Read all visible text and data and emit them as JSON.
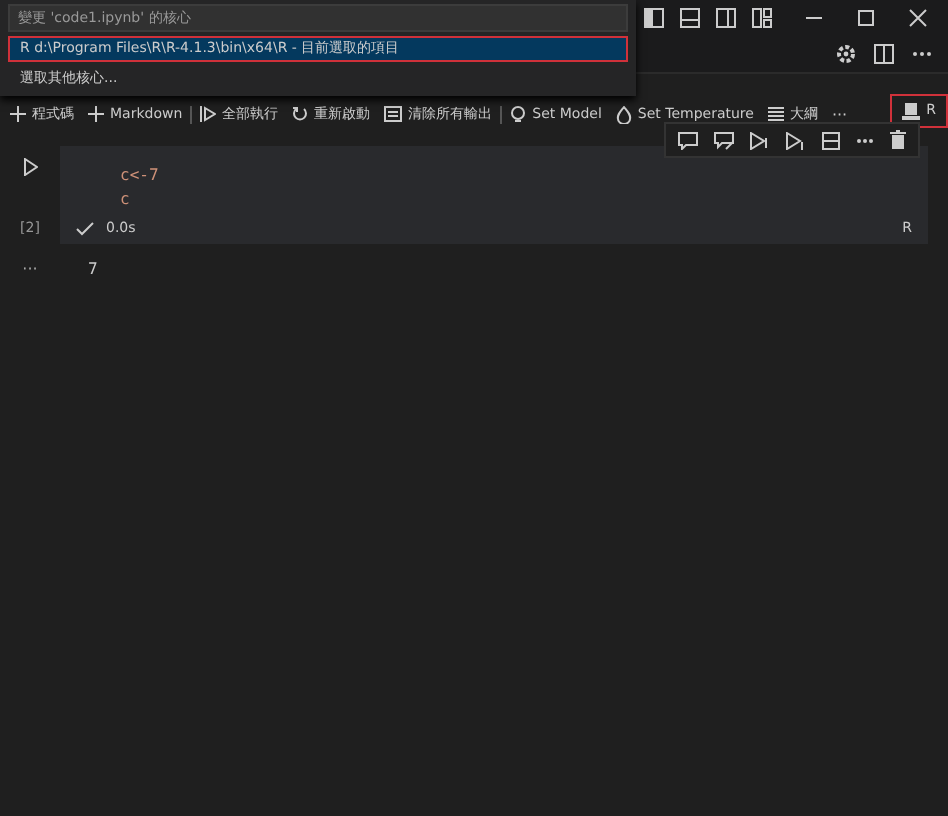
{
  "quick_pick": {
    "placeholder": "變更 'code1.ipynb' 的核心",
    "items": [
      {
        "label": "R d:\\Program Files\\R\\R-4.1.3\\bin\\x64\\R - 目前選取的項目",
        "selected": true
      },
      {
        "label": "選取其他核心...",
        "selected": false
      }
    ]
  },
  "toolbar": {
    "items": [
      {
        "kind": "plus",
        "label": "程式碼"
      },
      {
        "kind": "plus",
        "label": "Markdown"
      },
      {
        "kind": "run",
        "label": "全部執行"
      },
      {
        "kind": "restart",
        "label": "重新啟動"
      },
      {
        "kind": "clear",
        "label": "清除所有輸出"
      },
      {
        "kind": "model",
        "label": "Set Model"
      },
      {
        "kind": "temperature",
        "label": "Set Temperature"
      },
      {
        "kind": "outline",
        "label": "大綱"
      },
      {
        "kind": "more",
        "label": "···"
      }
    ],
    "kernel": {
      "label": "R",
      "selected": true
    }
  },
  "cell": {
    "execution_count": "[2]",
    "code_lines": [
      "c<-7",
      "c"
    ],
    "success": true,
    "duration": "0.0s",
    "language": "R",
    "output_marker": "···",
    "output": "7"
  }
}
